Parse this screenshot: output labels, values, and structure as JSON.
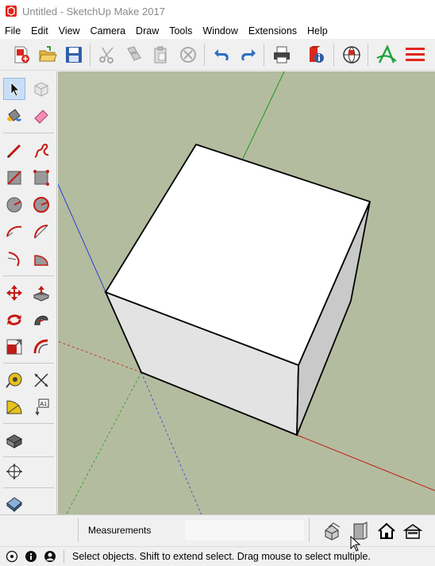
{
  "window": {
    "title": "Untitled - SketchUp Make 2017"
  },
  "menu": {
    "items": [
      "File",
      "Edit",
      "View",
      "Camera",
      "Draw",
      "Tools",
      "Window",
      "Extensions",
      "Help"
    ]
  },
  "measurements": {
    "label": "Measurements",
    "value": ""
  },
  "status": {
    "message": "Select objects. Shift to extend select. Drag mouse to select multiple."
  },
  "toolbar_icons": [
    "new-file-icon",
    "open-folder-icon",
    "save-icon",
    "cut-icon",
    "copy-icon",
    "paste-icon",
    "erase-icon",
    "undo-icon",
    "redo-icon",
    "print-icon",
    "model-info-icon",
    "geo-location-icon",
    "instructor-icon",
    "layers-icon"
  ],
  "left_tool_icons": [
    "select-icon",
    "make-component-icon",
    "paint-bucket-icon",
    "eraser-icon",
    "line-icon",
    "freehand-icon",
    "rectangle-icon",
    "rotated-rectangle-icon",
    "circle-icon",
    "polygon-icon",
    "arc-icon",
    "two-point-arc-icon",
    "three-point-arc-icon",
    "pie-icon",
    "move-icon",
    "push-pull-icon",
    "rotate-icon",
    "follow-me-icon",
    "scale-icon",
    "offset-icon",
    "tape-measure-icon",
    "dimension-icon",
    "protractor-icon",
    "text-icon",
    "warehouse-icon",
    "sandbox-icon",
    "section-plane-icon"
  ],
  "colors": {
    "viewport": "#b4bc9f",
    "accent_red": "#e1251b",
    "select_highlight": "#c9dff5"
  }
}
